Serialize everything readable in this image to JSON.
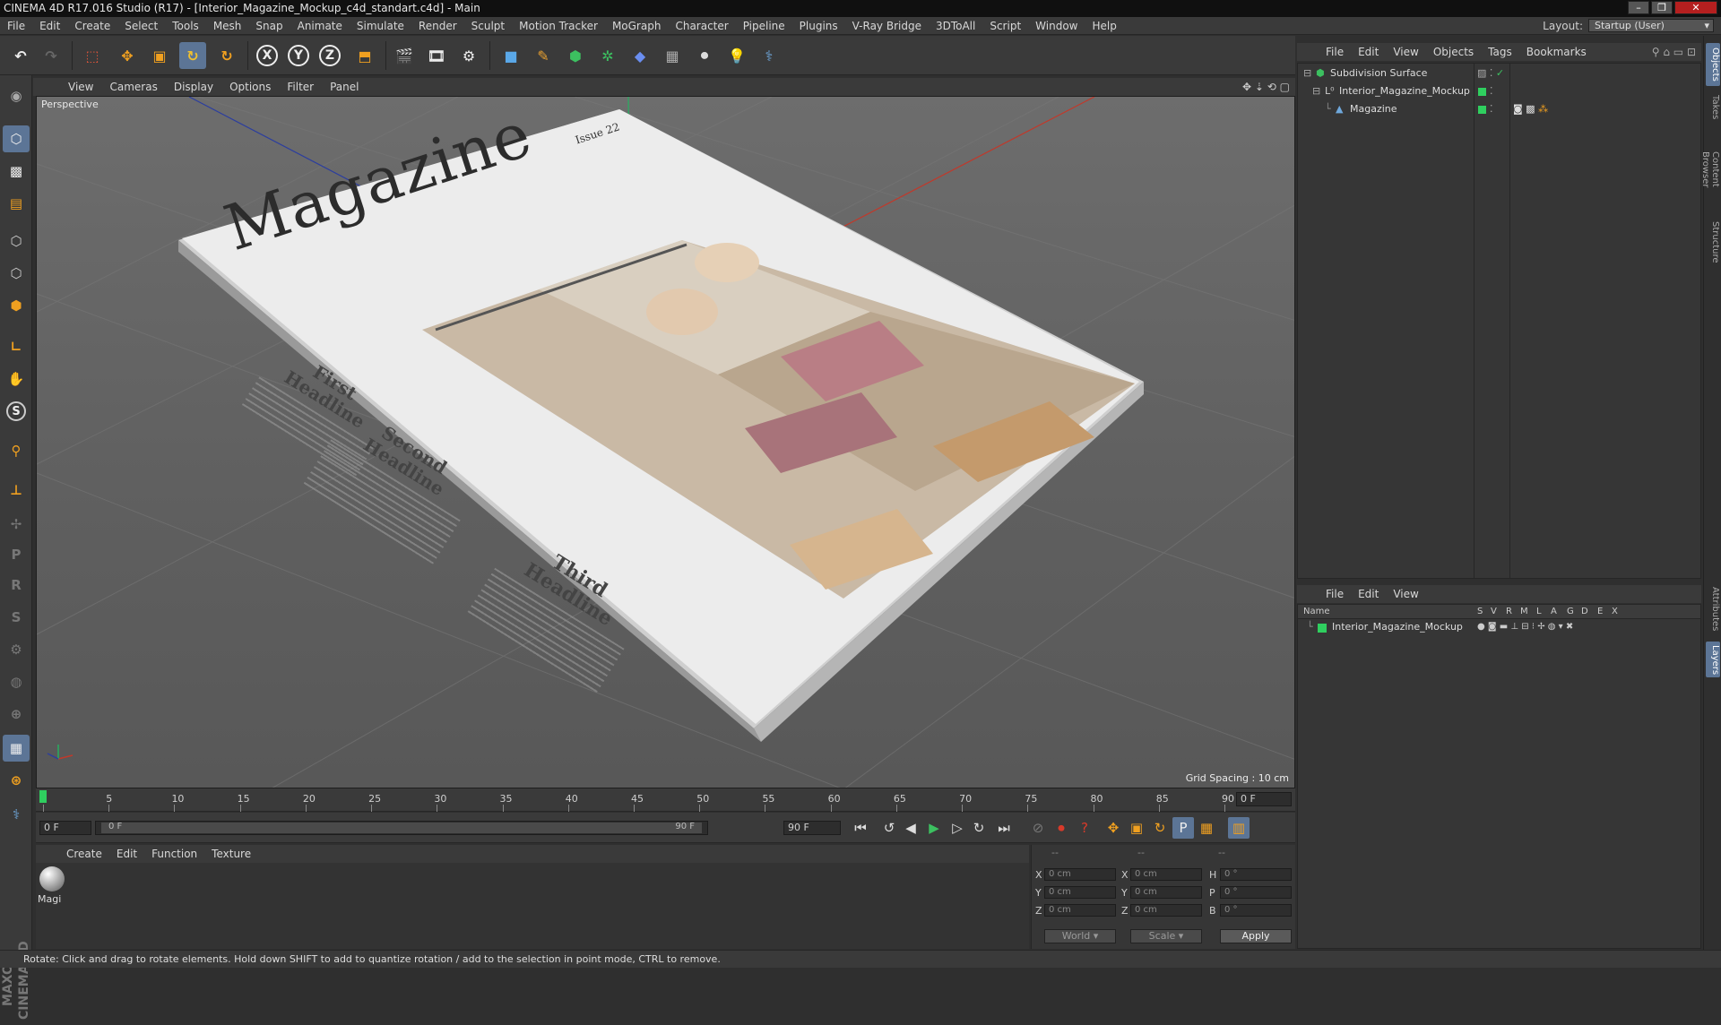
{
  "window": {
    "title": "CINEMA 4D R17.016 Studio (R17) - [Interior_Magazine_Mockup_c4d_standart.c4d] - Main"
  },
  "menubar": {
    "items": [
      "File",
      "Edit",
      "Create",
      "Select",
      "Tools",
      "Mesh",
      "Snap",
      "Animate",
      "Simulate",
      "Render",
      "Sculpt",
      "Motion Tracker",
      "MoGraph",
      "Character",
      "Pipeline",
      "Plugins",
      "V-Ray Bridge",
      "3DToAll",
      "Script",
      "Window",
      "Help"
    ],
    "layout_label": "Layout:",
    "layout_value": "Startup (User)"
  },
  "viewport": {
    "menu": [
      "View",
      "Cameras",
      "Display",
      "Options",
      "Filter",
      "Panel"
    ],
    "label": "Perspective",
    "grid_spacing": "Grid Spacing : 10 cm",
    "magazine": {
      "masthead": "Magazine",
      "issue": "Issue 22",
      "headlines": [
        {
          "l1": "First",
          "l2": "Headline"
        },
        {
          "l1": "Second",
          "l2": "Headline"
        },
        {
          "l1": "Third",
          "l2": "Headline"
        }
      ]
    }
  },
  "timeline": {
    "ticks": [
      "0",
      "5",
      "10",
      "15",
      "20",
      "25",
      "30",
      "35",
      "40",
      "45",
      "50",
      "55",
      "60",
      "65",
      "70",
      "75",
      "80",
      "85",
      "90"
    ],
    "current_frame": "0 F"
  },
  "transport": {
    "start_field": "0 F",
    "range_start": "0 F",
    "range_end": "90 F",
    "end_field": "90 F"
  },
  "material_manager": {
    "menu": [
      "Create",
      "Edit",
      "Function",
      "Texture"
    ],
    "materials": [
      {
        "name": "Magi"
      }
    ]
  },
  "coordinates": {
    "headers": [
      "--",
      "--",
      "--"
    ],
    "rows": [
      {
        "a": "X",
        "av": "0 cm",
        "b": "X",
        "bv": "0 cm",
        "c": "H",
        "cv": "0 °"
      },
      {
        "a": "Y",
        "av": "0 cm",
        "b": "Y",
        "bv": "0 cm",
        "c": "P",
        "cv": "0 °"
      },
      {
        "a": "Z",
        "av": "0 cm",
        "b": "Z",
        "bv": "0 cm",
        "c": "B",
        "cv": "0 °"
      }
    ],
    "mode_world": "World",
    "mode_scale": "Scale",
    "apply": "Apply"
  },
  "statusbar": {
    "text": "Rotate: Click and drag to rotate elements. Hold down SHIFT to add to quantize rotation / add to the selection in point mode, CTRL to remove."
  },
  "object_manager": {
    "menu": [
      "File",
      "Edit",
      "View",
      "Objects",
      "Tags",
      "Bookmarks"
    ],
    "objects": [
      {
        "name": "Subdivision Surface"
      },
      {
        "name": "Interior_Magazine_Mockup"
      },
      {
        "name": "Magazine"
      }
    ]
  },
  "layer_manager": {
    "menu": [
      "File",
      "Edit",
      "View"
    ],
    "columns": [
      "Name",
      "S",
      "V",
      "R",
      "M",
      "L",
      "A",
      "G",
      "D",
      "E",
      "X"
    ],
    "layers": [
      {
        "name": "Interior_Magazine_Mockup",
        "color": "#2fcf5f"
      }
    ]
  },
  "right_tabs": [
    "Objects",
    "Takes",
    "Content Browser",
    "Structure",
    "Attributes",
    "Layers"
  ],
  "colors": {
    "accent": "#5c7596",
    "layer_green": "#2fcf5f",
    "axis_x": "#c0392b",
    "axis_y": "#27ae60",
    "axis_z": "#2c3e9e"
  }
}
